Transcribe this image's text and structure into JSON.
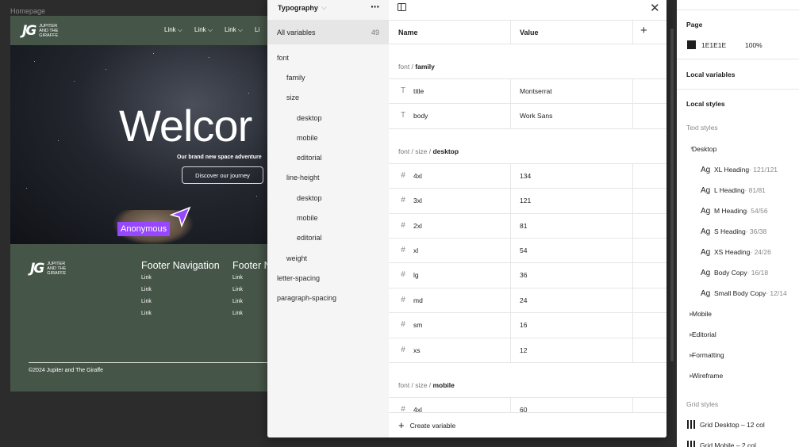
{
  "canvas": {
    "frame_label": "Homepage",
    "site": {
      "logo_mark": "JG",
      "logo_text": "JUPITER AND THE GIRAFFE",
      "nav_links": [
        "Link",
        "Link",
        "Link",
        "Li"
      ],
      "hero_title": "Welcor",
      "hero_subtitle": "Our brand new space adventure",
      "hero_button": "Discover our journey",
      "footer_columns": [
        {
          "heading": "Footer Navigation",
          "links": [
            "Link",
            "Link",
            "Link",
            "Link"
          ]
        },
        {
          "heading": "Footer N",
          "links": [
            "Link",
            "Link",
            "Link",
            "Link"
          ]
        }
      ],
      "copyright": "©2024 Jupiter and The Giraffe"
    },
    "cursor_label": "Anonymous"
  },
  "modal": {
    "collection_name": "Typography",
    "all_variables_label": "All variables",
    "all_variables_count": "49",
    "groups": [
      {
        "label": "font",
        "depth": 0
      },
      {
        "label": "family",
        "depth": 1
      },
      {
        "label": "size",
        "depth": 1
      },
      {
        "label": "desktop",
        "depth": 2
      },
      {
        "label": "mobile",
        "depth": 2
      },
      {
        "label": "editorial",
        "depth": 2
      },
      {
        "label": "line-height",
        "depth": 1
      },
      {
        "label": "desktop",
        "depth": 2
      },
      {
        "label": "mobile",
        "depth": 2
      },
      {
        "label": "editorial",
        "depth": 2
      },
      {
        "label": "weight",
        "depth": 1
      },
      {
        "label": "letter-spacing",
        "depth": 0
      },
      {
        "label": "paragraph-spacing",
        "depth": 0
      }
    ],
    "columns": {
      "name": "Name",
      "value": "Value"
    },
    "sections": [
      {
        "path": "font / ",
        "leaf": "family",
        "rows": [
          {
            "icon": "text-type-icon",
            "name": "title",
            "value": "Montserrat"
          },
          {
            "icon": "text-type-icon",
            "name": "body",
            "value": "Work Sans"
          }
        ]
      },
      {
        "path": "font / size / ",
        "leaf": "desktop",
        "rows": [
          {
            "icon": "number-type-icon",
            "name": "4xl",
            "value": "134"
          },
          {
            "icon": "number-type-icon",
            "name": "3xl",
            "value": "121"
          },
          {
            "icon": "number-type-icon",
            "name": "2xl",
            "value": "81"
          },
          {
            "icon": "number-type-icon",
            "name": "xl",
            "value": "54"
          },
          {
            "icon": "number-type-icon",
            "name": "lg",
            "value": "36"
          },
          {
            "icon": "number-type-icon",
            "name": "md",
            "value": "24"
          },
          {
            "icon": "number-type-icon",
            "name": "sm",
            "value": "16"
          },
          {
            "icon": "number-type-icon",
            "name": "xs",
            "value": "12"
          }
        ]
      },
      {
        "path": "font / size / ",
        "leaf": "mobile",
        "rows": [
          {
            "icon": "number-type-icon",
            "name": "4xl",
            "value": "60"
          }
        ]
      }
    ],
    "create_label": "Create variable"
  },
  "right_panel": {
    "page_heading": "Page",
    "page_color": "1E1E1E",
    "page_opacity": "100%",
    "local_variables": "Local variables",
    "local_styles": "Local styles",
    "text_styles_heading": "Text styles",
    "text_styles": [
      {
        "kind": "group",
        "label": "Desktop",
        "expanded": true
      },
      {
        "kind": "style",
        "label": "XL Heading",
        "meta": " · 121/121"
      },
      {
        "kind": "style",
        "label": "L Heading",
        "meta": " · 81/81"
      },
      {
        "kind": "style",
        "label": "M Heading",
        "meta": " · 54/56"
      },
      {
        "kind": "style",
        "label": "S Heading",
        "meta": " · 36/38"
      },
      {
        "kind": "style",
        "label": "XS Heading",
        "meta": " · 24/26"
      },
      {
        "kind": "style",
        "label": "Body Copy",
        "meta": " · 16/18"
      },
      {
        "kind": "style",
        "label": "Small Body Copy",
        "meta": " · 12/14"
      },
      {
        "kind": "group",
        "label": "Mobile",
        "expanded": false
      },
      {
        "kind": "group",
        "label": "Editorial",
        "expanded": false
      },
      {
        "kind": "group",
        "label": "Formatting",
        "expanded": false
      },
      {
        "kind": "group",
        "label": "Wireframe",
        "expanded": false
      }
    ],
    "grid_styles_heading": "Grid styles",
    "grid_styles": [
      "Grid Desktop – 12 col",
      "Grid Mobile – 2 col"
    ]
  },
  "colors": {
    "accent": "#9747ff",
    "site_green": "#455548",
    "panel_bg": "#f5f5f5"
  }
}
